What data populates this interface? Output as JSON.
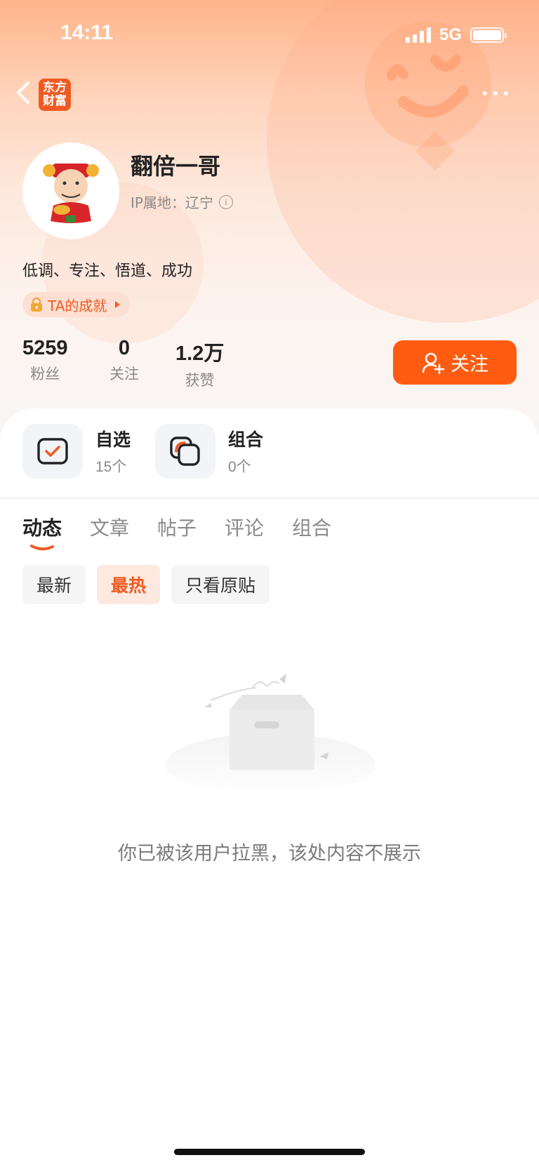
{
  "status_bar": {
    "time": "14:11",
    "network": "5G"
  },
  "header": {
    "logo_line1": "东方",
    "logo_line2": "财富",
    "username": "翻倍一哥",
    "ip_label": "IP属地：辽宁",
    "bio": "低调、专注、悟道、成功",
    "achievement_label": "TA的成就"
  },
  "stats": [
    {
      "value": "5259",
      "label": "粉丝"
    },
    {
      "value": "0",
      "label": "关注"
    },
    {
      "value": "1.2万",
      "label": "获赞"
    }
  ],
  "follow_button": "关注",
  "quick_entries": [
    {
      "title": "自选",
      "sub": "15个"
    },
    {
      "title": "组合",
      "sub": "0个"
    }
  ],
  "tabs": [
    "动态",
    "文章",
    "帖子",
    "评论",
    "组合"
  ],
  "filters": [
    "最新",
    "最热",
    "只看原贴"
  ],
  "empty_message": "你已被该用户拉黑，该处内容不展示",
  "colors": {
    "accent": "#ff5c12",
    "brand": "#f05a22"
  }
}
